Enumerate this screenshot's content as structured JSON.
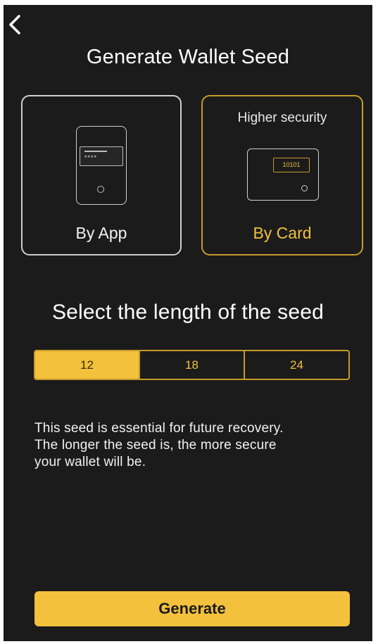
{
  "header": {
    "back_icon": "chevron-left-icon",
    "title": "Generate Wallet Seed"
  },
  "options": {
    "app": {
      "label": "By App",
      "icon": "phone-app-icon",
      "screen_dots": "****"
    },
    "card": {
      "caption": "Higher security",
      "label": "By Card",
      "icon": "card-device-icon",
      "chip_text": "10101"
    }
  },
  "seed_length": {
    "title": "Select the length of the seed",
    "options": [
      "12",
      "18",
      "24"
    ],
    "selected": "12"
  },
  "description": {
    "line1": "This seed is essential for future recovery.",
    "line2": "The longer the seed is, the more secure",
    "line3": "your wallet will be."
  },
  "actions": {
    "generate_label": "Generate"
  },
  "colors": {
    "background": "#1b1b1b",
    "accent": "#f3c13c",
    "accent_border": "#c79a2a",
    "text": "#ffffff"
  }
}
